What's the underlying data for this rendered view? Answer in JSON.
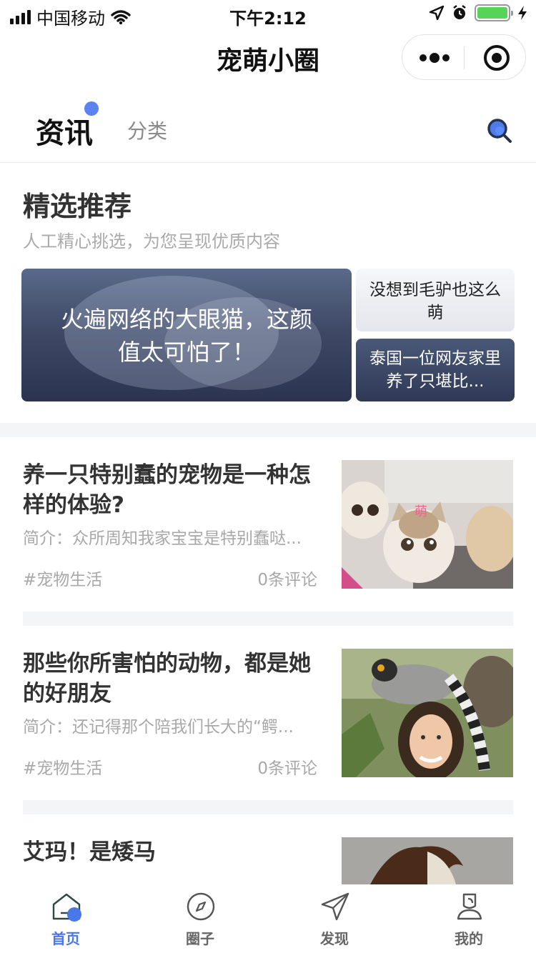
{
  "status_bar": {
    "carrier": "中国移动",
    "time": "下午2:12",
    "battery_color": "#58d35a"
  },
  "nav": {
    "title": "宠萌小圈",
    "more_icon": "more-dots-icon",
    "close_icon": "target-circle-icon"
  },
  "tabs": {
    "active": "资讯",
    "inactive": "分类",
    "indicator_color": "#5b82ee",
    "search_icon": "search-icon"
  },
  "featured": {
    "title": "精选推荐",
    "subtitle": "人工精心挑选，为您呈现优质内容",
    "main": "火遍网络的大眼猫，这颜值太可怕了！",
    "side_top": "没想到毛驴也这么萌",
    "side_bottom": "泰国一位网友家里养了只堪比..."
  },
  "articles": [
    {
      "title": "养一只特别蠢的宠物是一种怎样的体验?",
      "intro": "简介：众所周知我家宝宝是特别蠢哒...",
      "tag": "#宠物生活",
      "comments": "0条评论",
      "image_label": "萌"
    },
    {
      "title": "那些你所害怕的动物，都是她的好朋友",
      "intro": "简介：还记得那个陪我们长大的“鳄...",
      "tag": "#宠物生活",
      "comments": "0条评论"
    },
    {
      "title": "艾玛！是矮马"
    }
  ],
  "tabbar": {
    "items": [
      {
        "label": "首页",
        "icon": "home-icon"
      },
      {
        "label": "圈子",
        "icon": "compass-icon"
      },
      {
        "label": "发现",
        "icon": "paper-plane-icon"
      },
      {
        "label": "我的",
        "icon": "user-icon"
      }
    ],
    "active_color": "#4b78e8"
  }
}
